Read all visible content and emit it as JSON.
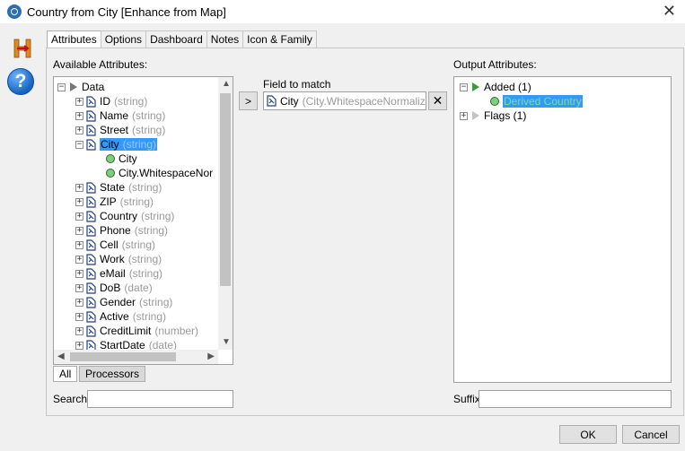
{
  "window": {
    "title": "Country from City [Enhance from Map]",
    "close_glyph": "✕"
  },
  "tabs": [
    {
      "label": "Attributes",
      "active": true
    },
    {
      "label": "Options"
    },
    {
      "label": "Dashboard"
    },
    {
      "label": "Notes"
    },
    {
      "label": "Icon & Family"
    }
  ],
  "available": {
    "label": "Available Attributes:",
    "root": "Data",
    "items": [
      {
        "name": "ID",
        "type": "(string)"
      },
      {
        "name": "Name",
        "type": "(string)"
      },
      {
        "name": "Street",
        "type": "(string)"
      },
      {
        "name": "City",
        "type": "(string)",
        "selected": true,
        "expanded": true,
        "children": [
          "City",
          "City.WhitespaceNor"
        ]
      },
      {
        "name": "State",
        "type": "(string)"
      },
      {
        "name": "ZIP",
        "type": "(string)"
      },
      {
        "name": "Country",
        "type": "(string)"
      },
      {
        "name": "Phone",
        "type": "(string)"
      },
      {
        "name": "Cell",
        "type": "(string)"
      },
      {
        "name": "Work",
        "type": "(string)"
      },
      {
        "name": "eMail",
        "type": "(string)"
      },
      {
        "name": "DoB",
        "type": "(date)"
      },
      {
        "name": "Gender",
        "type": "(string)"
      },
      {
        "name": "Active",
        "type": "(string)"
      },
      {
        "name": "CreditLimit",
        "type": "(number)"
      },
      {
        "name": "StartDate",
        "type": "(date)"
      }
    ],
    "bottom_tabs": [
      "All",
      "Processors"
    ]
  },
  "match": {
    "label": "Field to match",
    "arrow": ">",
    "field_name": "City",
    "field_source": "(City.WhitespaceNormalized)",
    "clear_glyph": "✕"
  },
  "output": {
    "label": "Output Attributes:",
    "added": "Added (1)",
    "derived": "Derived Country",
    "flags": "Flags (1)"
  },
  "search": {
    "label": "Search",
    "value": ""
  },
  "suffix": {
    "label": "Suffix",
    "value": ""
  },
  "buttons": {
    "ok": "OK",
    "cancel": "Cancel"
  },
  "icons": {
    "help": "?",
    "tree_collapse": "−",
    "tree_expand": "+"
  }
}
